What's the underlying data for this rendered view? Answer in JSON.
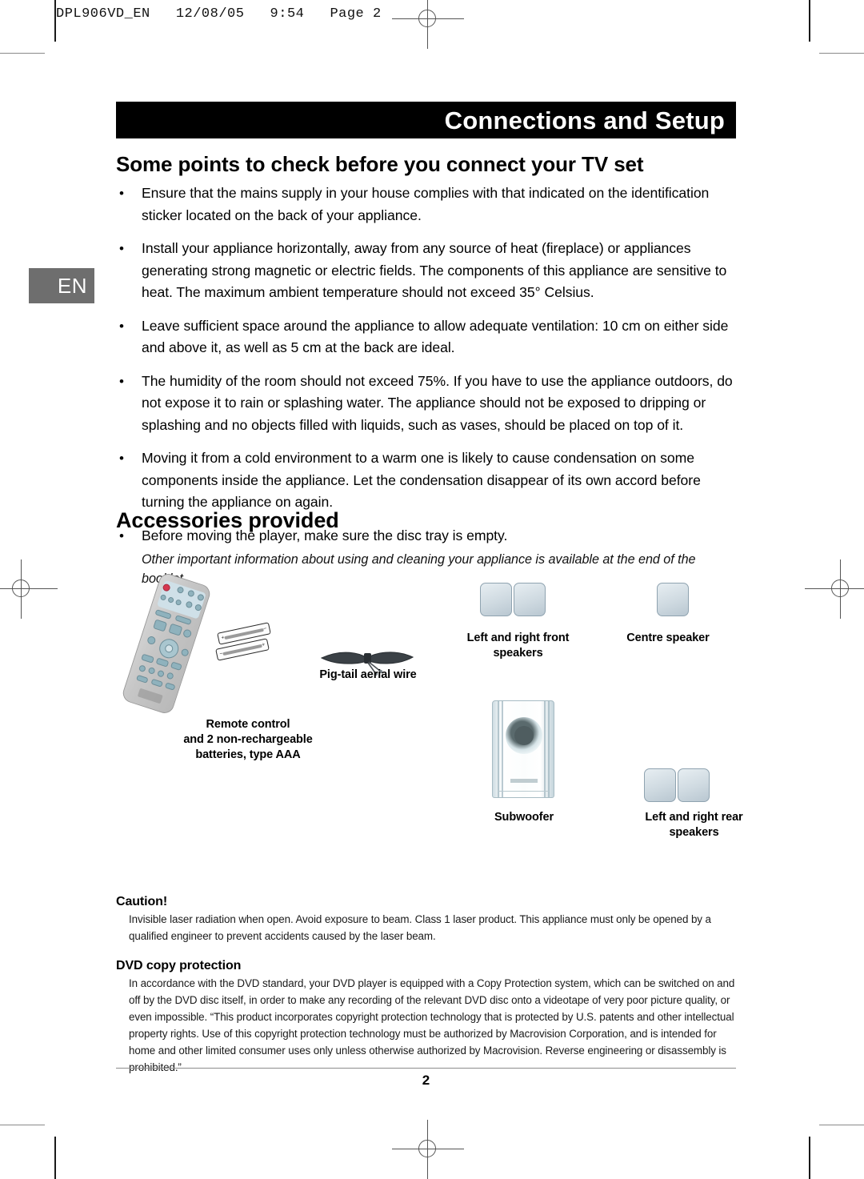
{
  "document": {
    "print_header": "DPL906VD_EN   12/08/05   9:54   Page 2",
    "language_tab": "EN",
    "page_number": "2",
    "banner_title": "Connections and Setup"
  },
  "sections": {
    "points": {
      "heading": "Some points to check before you connect your TV set",
      "bullet_glyph": "•",
      "items": [
        "Ensure that the mains supply in your house complies with that indicated on the identification sticker located on the back of your appliance.",
        "Install your appliance horizontally, away from any source of heat (fireplace) or appliances generating strong magnetic or electric fields. The components of this appliance are sensitive to heat. The maximum ambient temperature should not exceed 35° Celsius.",
        "Leave sufficient space around the appliance to allow adequate ventilation: 10 cm on either side and above it, as well as 5 cm at the back are ideal.",
        "The humidity of the room should not exceed 75%. If you have to use the appliance outdoors, do not expose it to rain or splashing water. The appliance should not be exposed to dripping or splashing and no objects filled with liquids, such as vases, should be placed on top of it.",
        "Moving it from a cold environment to a warm one is likely to cause condensation on some components inside the appliance. Let the condensation disappear of its own accord before turning the appliance on again.",
        "Before moving the player, make sure the disc tray is empty."
      ],
      "footnote": "Other important information about using and cleaning your appliance is available at the end of the booklet."
    },
    "accessories": {
      "heading": "Accessories provided",
      "captions": {
        "remote": "Remote control\nand 2 non-rechargeable\nbatteries, type AAA",
        "aerial": "Pig-tail aerial wire",
        "front_speakers": "Left and right front\nspeakers",
        "centre_speaker": "Centre speaker",
        "subwoofer": "Subwoofer",
        "rear_speakers": "Left and right rear\nspeakers"
      }
    },
    "legal": {
      "caution_heading": "Caution!",
      "caution_body": "Invisible laser radiation when open. Avoid exposure to beam. Class 1 laser product. This appliance must only be opened by a qualified engineer to prevent accidents caused by the laser beam.",
      "copy_heading": "DVD copy protection",
      "copy_body": "In accordance with the DVD standard, your DVD player is equipped  with  a  Copy Protection system, which can be switched on and off by the DVD disc itself, in order to make any recording of the relevant DVD disc onto a videotape of very poor picture quality, or even impossible. “This product incorporates copyright protection technology that is protected by U.S. patents and other intellectual property rights. Use of this copyright protection technology must be authorized by Macrovision Corporation, and is intended for home and other limited consumer uses only unless otherwise authorized by Macrovision. Reverse engineering or disassembly is prohibited.”"
    }
  },
  "colors": {
    "banner_background": "#000000",
    "banner_text": "#ffffff",
    "language_tab_background": "#6e6e6e",
    "speaker_body": "#cfdae1",
    "remote_button": "#8fb2bd",
    "remote_power_button": "#d6374f"
  }
}
